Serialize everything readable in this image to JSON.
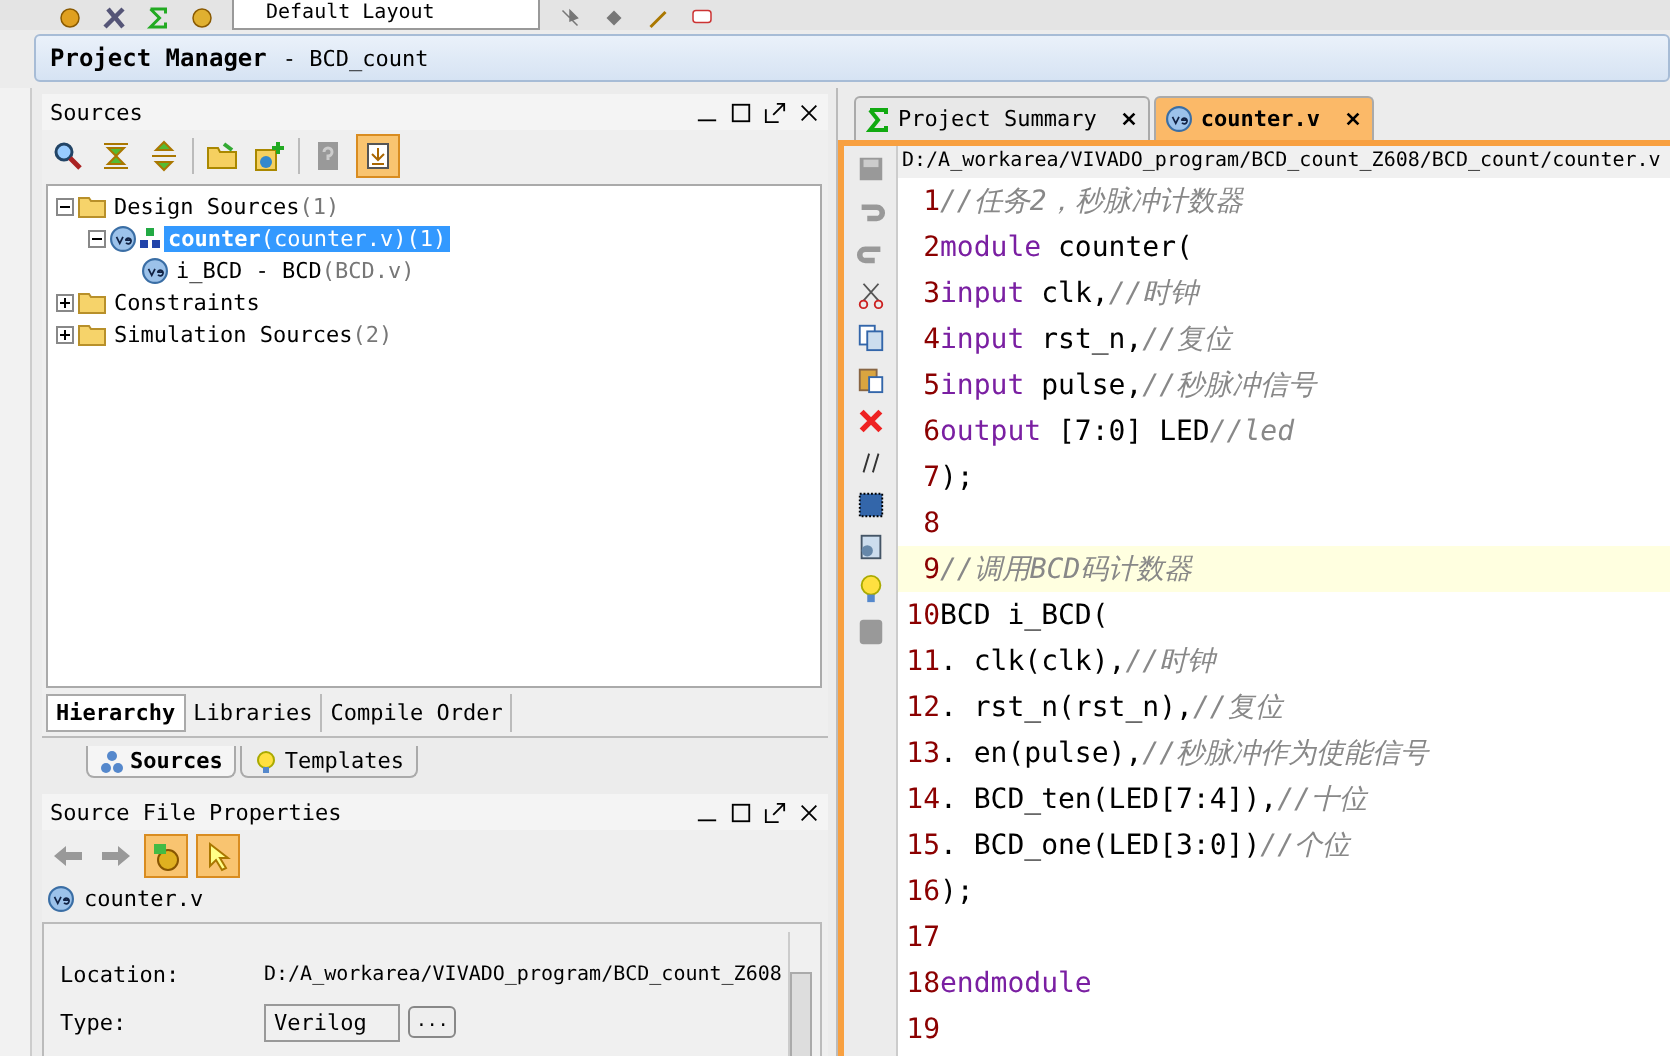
{
  "toolbar": {
    "layout_dropdown": "Default Layout"
  },
  "header": {
    "title": "Project Manager",
    "subtitle": "- BCD_count"
  },
  "sources_panel": {
    "title": "Sources",
    "tree": [
      {
        "kind": "folder",
        "label": "Design Sources",
        "count": "(1)",
        "expanded": true,
        "selected": false,
        "children": [
          {
            "kind": "module",
            "label": "counter",
            "file": "(counter.v)",
            "count": "(1)",
            "expanded": true,
            "selected": true,
            "children": [
              {
                "kind": "file",
                "label": "i_BCD - BCD",
                "file": "(BCD.v)",
                "selected": false
              }
            ]
          }
        ]
      },
      {
        "kind": "folder",
        "label": "Constraints",
        "expanded": false,
        "selected": false
      },
      {
        "kind": "folder",
        "label": "Simulation Sources",
        "count": "(2)",
        "expanded": false,
        "selected": false
      }
    ],
    "view_tabs": [
      {
        "label": "Hierarchy",
        "selected": true
      },
      {
        "label": "Libraries",
        "selected": false
      },
      {
        "label": "Compile Order",
        "selected": false
      }
    ],
    "bottom_tabs": [
      {
        "kind": "sources",
        "label": "Sources",
        "selected": true
      },
      {
        "kind": "templates",
        "label": "Templates",
        "selected": false
      }
    ]
  },
  "properties_panel": {
    "title": "Source File Properties",
    "file": "counter.v",
    "fields": [
      {
        "kind": "text",
        "label": "Location:",
        "value": "D:/A_workarea/VIVADO_program/BCD_count_Z608"
      },
      {
        "kind": "select",
        "label": "Type:",
        "value": "Verilog",
        "button": "..."
      }
    ]
  },
  "editor": {
    "tabs": [
      {
        "kind": "summary",
        "label": "Project Summary",
        "selected": false
      },
      {
        "kind": "verilog",
        "label": "counter.v",
        "selected": true
      }
    ],
    "path": "D:/A_workarea/VIVADO_program/BCD_count_Z608/BCD_count/counter.v",
    "lines": [
      {
        "number": "1",
        "highlighted": false,
        "segments": [
          {
            "kind": "comment",
            "text": "//任务2，秒脉冲计数器"
          }
        ]
      },
      {
        "number": "2",
        "highlighted": false,
        "segments": [
          {
            "kind": "keyword",
            "text": "module"
          },
          {
            "kind": "plain",
            "text": " counter("
          }
        ]
      },
      {
        "number": "3",
        "highlighted": false,
        "segments": [
          {
            "kind": "keyword",
            "text": "input"
          },
          {
            "kind": "plain",
            "text": " clk,"
          },
          {
            "kind": "comment",
            "text": "//时钟"
          }
        ]
      },
      {
        "number": "4",
        "highlighted": false,
        "segments": [
          {
            "kind": "keyword",
            "text": "input"
          },
          {
            "kind": "plain",
            "text": " rst_n,"
          },
          {
            "kind": "comment",
            "text": "//复位"
          }
        ]
      },
      {
        "number": "5",
        "highlighted": false,
        "segments": [
          {
            "kind": "keyword",
            "text": "input"
          },
          {
            "kind": "plain",
            "text": " pulse,"
          },
          {
            "kind": "comment",
            "text": "//秒脉冲信号"
          }
        ]
      },
      {
        "number": "6",
        "highlighted": false,
        "segments": [
          {
            "kind": "keyword",
            "text": "output"
          },
          {
            "kind": "plain",
            "text": " [7:0] LED"
          },
          {
            "kind": "comment",
            "text": "//led"
          }
        ]
      },
      {
        "number": "7",
        "highlighted": false,
        "segments": [
          {
            "kind": "plain",
            "text": ");"
          }
        ]
      },
      {
        "number": "8",
        "highlighted": false
      },
      {
        "number": "9",
        "highlighted": true,
        "segments": [
          {
            "kind": "comment",
            "text": "//调用BCD码计数器"
          }
        ]
      },
      {
        "number": "10",
        "highlighted": false,
        "segments": [
          {
            "kind": "plain",
            "text": "BCD i_BCD("
          }
        ]
      },
      {
        "number": "11",
        "highlighted": false,
        "segments": [
          {
            "kind": "plain",
            "text": ". clk(clk),"
          },
          {
            "kind": "comment",
            "text": "//时钟"
          }
        ]
      },
      {
        "number": "12",
        "highlighted": false,
        "segments": [
          {
            "kind": "plain",
            "text": ". rst_n(rst_n),"
          },
          {
            "kind": "comment",
            "text": "//复位"
          }
        ]
      },
      {
        "number": "13",
        "highlighted": false,
        "segments": [
          {
            "kind": "plain",
            "text": ". en(pulse),"
          },
          {
            "kind": "comment",
            "text": "//秒脉冲作为使能信号"
          }
        ]
      },
      {
        "number": "14",
        "highlighted": false,
        "segments": [
          {
            "kind": "plain",
            "text": ". BCD_ten(LED[7:4]),"
          },
          {
            "kind": "comment",
            "text": "//十位"
          }
        ]
      },
      {
        "number": "15",
        "highlighted": false,
        "segments": [
          {
            "kind": "plain",
            "text": ". BCD_one(LED[3:0])"
          },
          {
            "kind": "comment",
            "text": "//个位"
          }
        ]
      },
      {
        "number": "16",
        "highlighted": false,
        "segments": [
          {
            "kind": "plain",
            "text": ");"
          }
        ]
      },
      {
        "number": "17",
        "highlighted": false
      },
      {
        "number": "18",
        "highlighted": false,
        "segments": [
          {
            "kind": "keyword",
            "text": "endmodule"
          }
        ]
      },
      {
        "number": "19",
        "highlighted": false
      }
    ]
  }
}
